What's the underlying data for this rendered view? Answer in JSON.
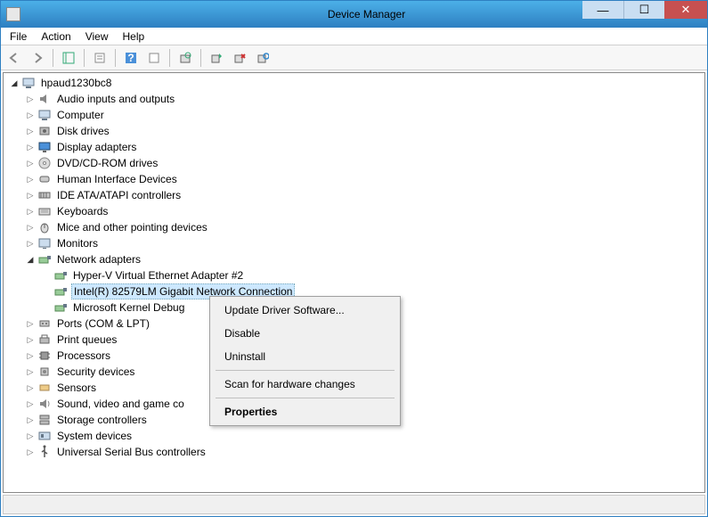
{
  "window": {
    "title": "Device Manager"
  },
  "menubar": [
    "File",
    "Action",
    "View",
    "Help"
  ],
  "root": "hpaud1230bc8",
  "categories": [
    {
      "label": "Audio inputs and outputs",
      "icon": "speaker"
    },
    {
      "label": "Computer",
      "icon": "computer"
    },
    {
      "label": "Disk drives",
      "icon": "disk"
    },
    {
      "label": "Display adapters",
      "icon": "display"
    },
    {
      "label": "DVD/CD-ROM drives",
      "icon": "cd"
    },
    {
      "label": "Human Interface Devices",
      "icon": "hid"
    },
    {
      "label": "IDE ATA/ATAPI controllers",
      "icon": "ide"
    },
    {
      "label": "Keyboards",
      "icon": "keyboard"
    },
    {
      "label": "Mice and other pointing devices",
      "icon": "mouse"
    },
    {
      "label": "Monitors",
      "icon": "monitor"
    },
    {
      "label": "Network adapters",
      "icon": "network",
      "expanded": true,
      "children": [
        {
          "label": "Hyper-V Virtual Ethernet Adapter #2",
          "icon": "network"
        },
        {
          "label": "Intel(R) 82579LM Gigabit Network Connection",
          "icon": "network",
          "selected": true
        },
        {
          "label": "Microsoft Kernel Debug",
          "icon": "network",
          "truncated": true
        }
      ]
    },
    {
      "label": "Ports (COM & LPT)",
      "icon": "port"
    },
    {
      "label": "Print queues",
      "icon": "printer"
    },
    {
      "label": "Processors",
      "icon": "cpu"
    },
    {
      "label": "Security devices",
      "icon": "security"
    },
    {
      "label": "Sensors",
      "icon": "sensor"
    },
    {
      "label": "Sound, video and game co",
      "icon": "sound",
      "truncated": true
    },
    {
      "label": "Storage controllers",
      "icon": "storage"
    },
    {
      "label": "System devices",
      "icon": "system"
    },
    {
      "label": "Universal Serial Bus controllers",
      "icon": "usb"
    }
  ],
  "context_menu": [
    {
      "label": "Update Driver Software...",
      "type": "item"
    },
    {
      "label": "Disable",
      "type": "item"
    },
    {
      "label": "Uninstall",
      "type": "item"
    },
    {
      "type": "sep"
    },
    {
      "label": "Scan for hardware changes",
      "type": "item"
    },
    {
      "type": "sep"
    },
    {
      "label": "Properties",
      "type": "item",
      "bold": true
    }
  ]
}
